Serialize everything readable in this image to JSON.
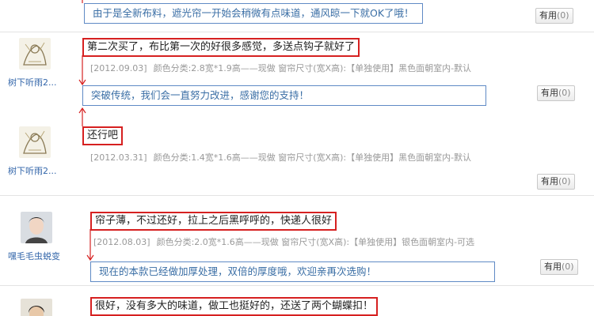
{
  "top_partial": {
    "reply": "由于是全新布料，遮光帘一开始会稍微有点味道，通风晾一下就OK了哦！",
    "useful_label": "有用",
    "useful_count": "(0)"
  },
  "reviews": [
    {
      "username": "树下听雨2...",
      "comment": "第二次买了，布比第一次的好很多感觉，多送点钩子就好了",
      "date": "[2012.09.03]",
      "spec": "颜色分类:2.8宽*1.9高——现做  窗帘尺寸(宽X高):【单独使用】黑色面朝室内-默认",
      "reply": "突破传统，我们会一直努力改进，感谢您的支持！",
      "useful_label": "有用",
      "useful_count": "(0)"
    },
    {
      "username": "树下听雨2...",
      "comment": "还行吧",
      "date": "[2012.03.31]",
      "spec": "颜色分类:1.4宽*1.6高——现做  窗帘尺寸(宽X高):【单独使用】黑色面朝室内-默认",
      "useful_label": "有用",
      "useful_count": "(0)"
    },
    {
      "username": "嘿毛毛虫蜕变",
      "comment": "帘子薄，不过还好，拉上之后黑呼呼的，快递人很好",
      "date": "[2012.08.03]",
      "spec": "颜色分类:2.0宽*1.6高——现做  窗帘尺寸(宽X高):【单独使用】银色面朝室内-可选",
      "reply": "现在的本款已经做加厚处理，双倍的厚度哦，欢迎亲再次选购！",
      "useful_label": "有用",
      "useful_count": "(0)"
    },
    {
      "comment": "很好，没有多大的味道，做工也挺好的，还送了两个蝴蝶扣！"
    }
  ]
}
